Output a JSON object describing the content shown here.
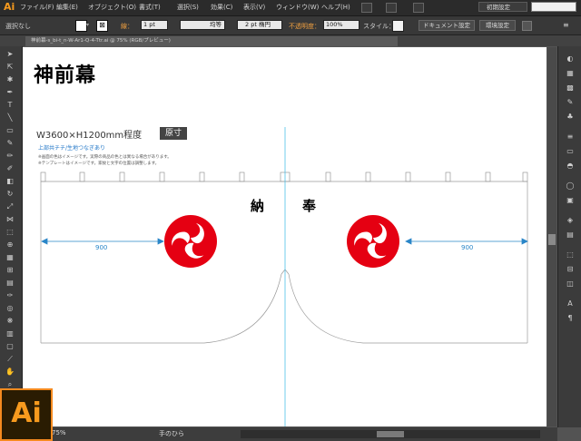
{
  "app": {
    "name": "Adobe Illustrator",
    "logo_text": "Ai",
    "workspace": "初期設定"
  },
  "menu": {
    "items": [
      "ファイル(F)",
      "編集(E)",
      "オブジェクト(O)",
      "書式(T)",
      "選択(S)",
      "効果(C)",
      "表示(V)",
      "ウィンドウ(W)",
      "ヘルプ(H)"
    ]
  },
  "controlbar": {
    "selection": "選択なし",
    "stroke_label": "線：",
    "stroke_weight": "1 pt",
    "stroke_style": "均等",
    "brush": "2 pt 楕円",
    "opacity_label": "不透明度：",
    "opacity": "100%",
    "style_label": "スタイル：",
    "doc_setup": "ドキュメント設定",
    "prefs": "環境設定"
  },
  "document": {
    "tab_label": "神前幕-s_bi-t_n-W-Ar1-Q-4-Ttr.ai @ 75% (RGB/プレビュー)"
  },
  "artwork": {
    "title": "神前幕",
    "size_text": "W3600×H1200mm程度",
    "badge": "原寸",
    "note_blue": "上部共チチ/生地つなぎあり",
    "note_line1": "※画面の色はイメージです。実際の商品の色とは異なる場合があります。",
    "note_line2": "※テンプレートはイメージです。家紋と文字の位置は調整します。",
    "left_char": "納",
    "right_char": "奉",
    "dim_left": "900",
    "dim_right": "900",
    "crest_color": "#e50012",
    "guide_color": "#4ec0e8"
  },
  "status": {
    "tool_name": "手のひら",
    "zoom": "75%"
  }
}
